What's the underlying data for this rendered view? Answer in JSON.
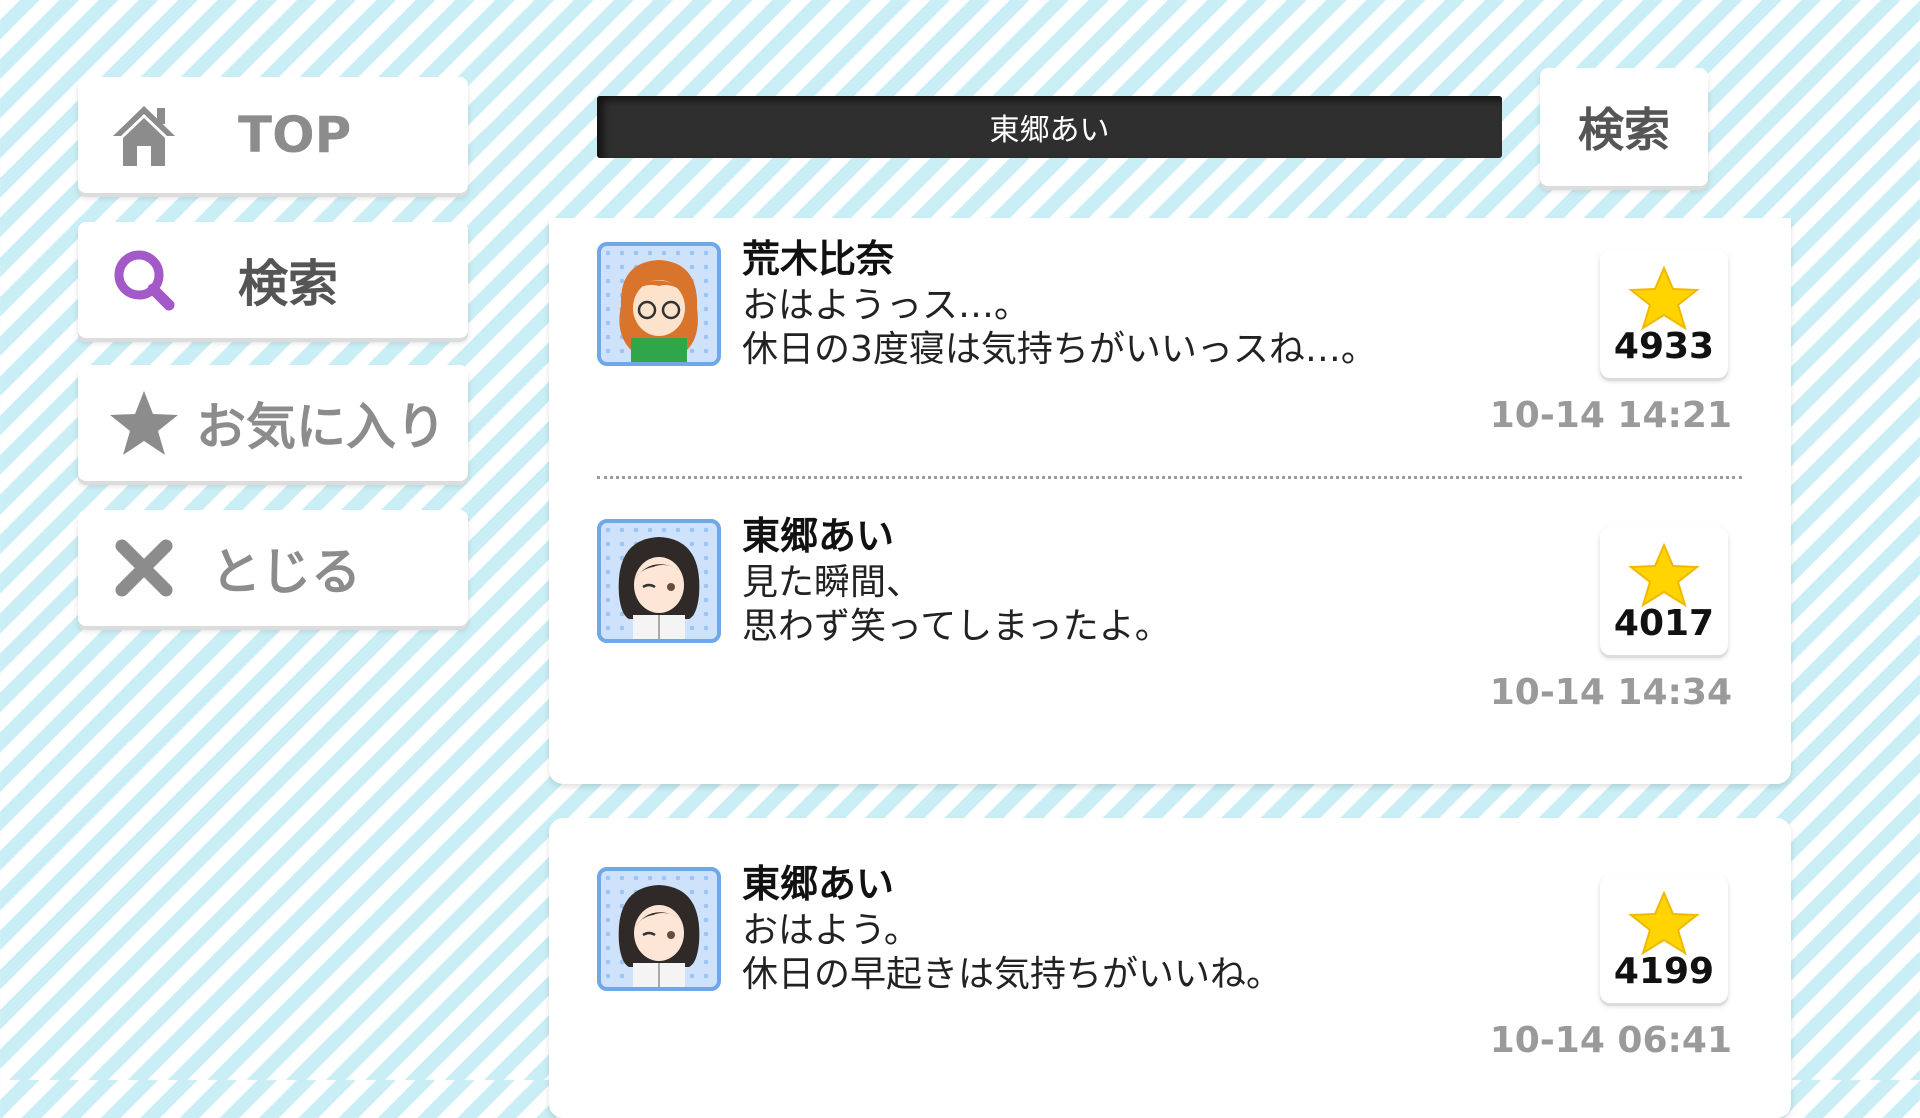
{
  "sidebar": {
    "top_label": "TOP",
    "search_label": "検索",
    "favorites_label": "お気に入り",
    "close_label": "とじる"
  },
  "search": {
    "value": "東郷あい",
    "button_label": "検索"
  },
  "colors": {
    "search_icon": "#a459c9",
    "star": "#ffd400",
    "avatar_border": "#6fa7e8"
  },
  "posts": [
    {
      "name": "荒木比奈",
      "line1": "おはようっス…。",
      "line2": "休日の3度寝は気持ちがいいっスね…。",
      "likes": "4933",
      "time": "10-14 14:21"
    },
    {
      "name": "東郷あい",
      "line1": "見た瞬間、",
      "line2": "思わず笑ってしまったよ。",
      "likes": "4017",
      "time": "10-14 14:34"
    },
    {
      "name": "東郷あい",
      "line1": "おはよう。",
      "line2": "休日の早起きは気持ちがいいね。",
      "likes": "4199",
      "time": "10-14 06:41"
    }
  ]
}
